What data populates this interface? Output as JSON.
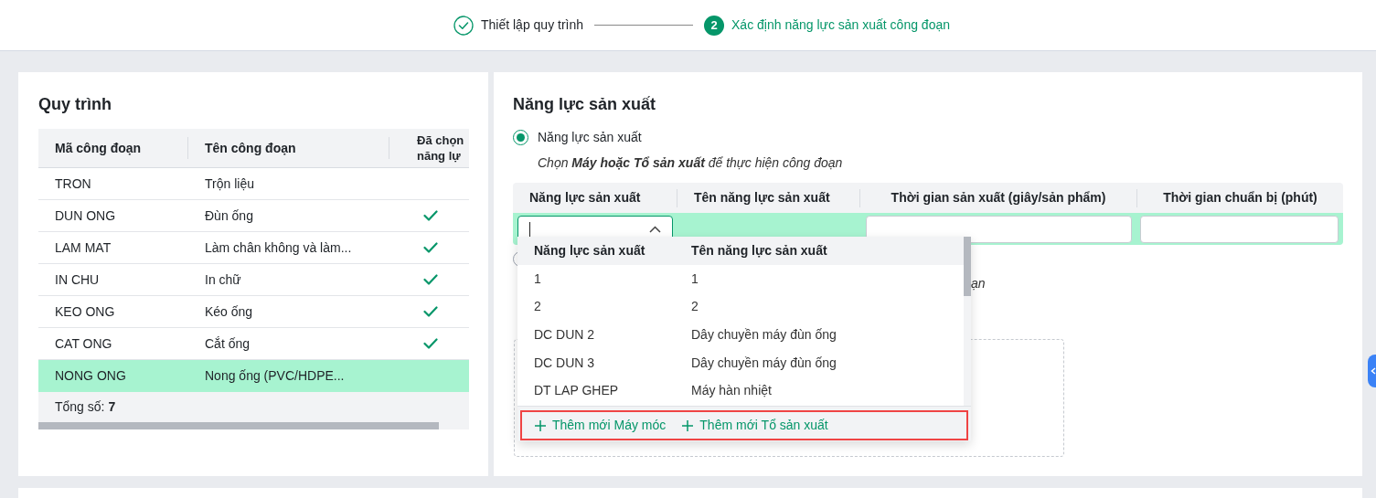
{
  "stepper": {
    "steps": [
      {
        "label": "Thiết lập quy trình",
        "completed": true,
        "selected": false
      },
      {
        "number": "2",
        "label": "Xác định năng lực sản xuất công đoạn",
        "completed": false,
        "selected": true
      }
    ]
  },
  "process_panel": {
    "title": "Quy trình",
    "columns": [
      "Mã công đoạn",
      "Tên công đoạn",
      "Đã chọn năng lự"
    ],
    "rows": [
      {
        "code": "TRON",
        "name": "Trộn liệu",
        "capacity_chosen": false,
        "selected": false
      },
      {
        "code": "DUN ONG",
        "name": "Đùn ống",
        "capacity_chosen": true,
        "selected": false
      },
      {
        "code": "LAM MAT",
        "name": "Làm chân không và làm...",
        "capacity_chosen": true,
        "selected": false
      },
      {
        "code": "IN CHU",
        "name": "In chữ",
        "capacity_chosen": true,
        "selected": false
      },
      {
        "code": "KEO ONG",
        "name": "Kéo ống",
        "capacity_chosen": true,
        "selected": false
      },
      {
        "code": "CAT ONG",
        "name": "Cắt ống",
        "capacity_chosen": true,
        "selected": false
      },
      {
        "code": "NONG ONG",
        "name": "Nong ống (PVC/HDPE...",
        "capacity_chosen": false,
        "selected": true
      }
    ],
    "total": "Tổng số: **7**"
  },
  "capacity_panel": {
    "title": "Năng lực sản xuất",
    "option": {
      "label": "Năng lực sản xuất",
      "selected": true,
      "hint": "Chọn **Máy hoặc Tổ sản xuất** để thực hiện công đoạn"
    },
    "other_option": {
      "selected": false
    },
    "hidden_hint_tail": "ạn",
    "columns": [
      "Năng lực sản xuất",
      "Tên năng lực sản xuất",
      "Thời gian sản xuất (giây/sản phẩm)",
      "Thời gian chuẩn bị (phút)"
    ],
    "dropdown": {
      "columns": [
        "Năng lực sản xuất",
        "Tên năng lực sản xuất"
      ],
      "rows": [
        {
          "code": "1",
          "name": "1"
        },
        {
          "code": "2",
          "name": "2"
        },
        {
          "code": "DC DUN 2",
          "name": "Dây chuyền máy đùn ống"
        },
        {
          "code": "DC DUN 3",
          "name": "Dây chuyền máy đùn ống"
        },
        {
          "code": "DT LAP GHEP",
          "name": "Máy hàn nhiệt"
        }
      ],
      "actions": [
        "Thêm mới Máy móc",
        "Thêm mới Tổ sản xuất"
      ]
    }
  }
}
